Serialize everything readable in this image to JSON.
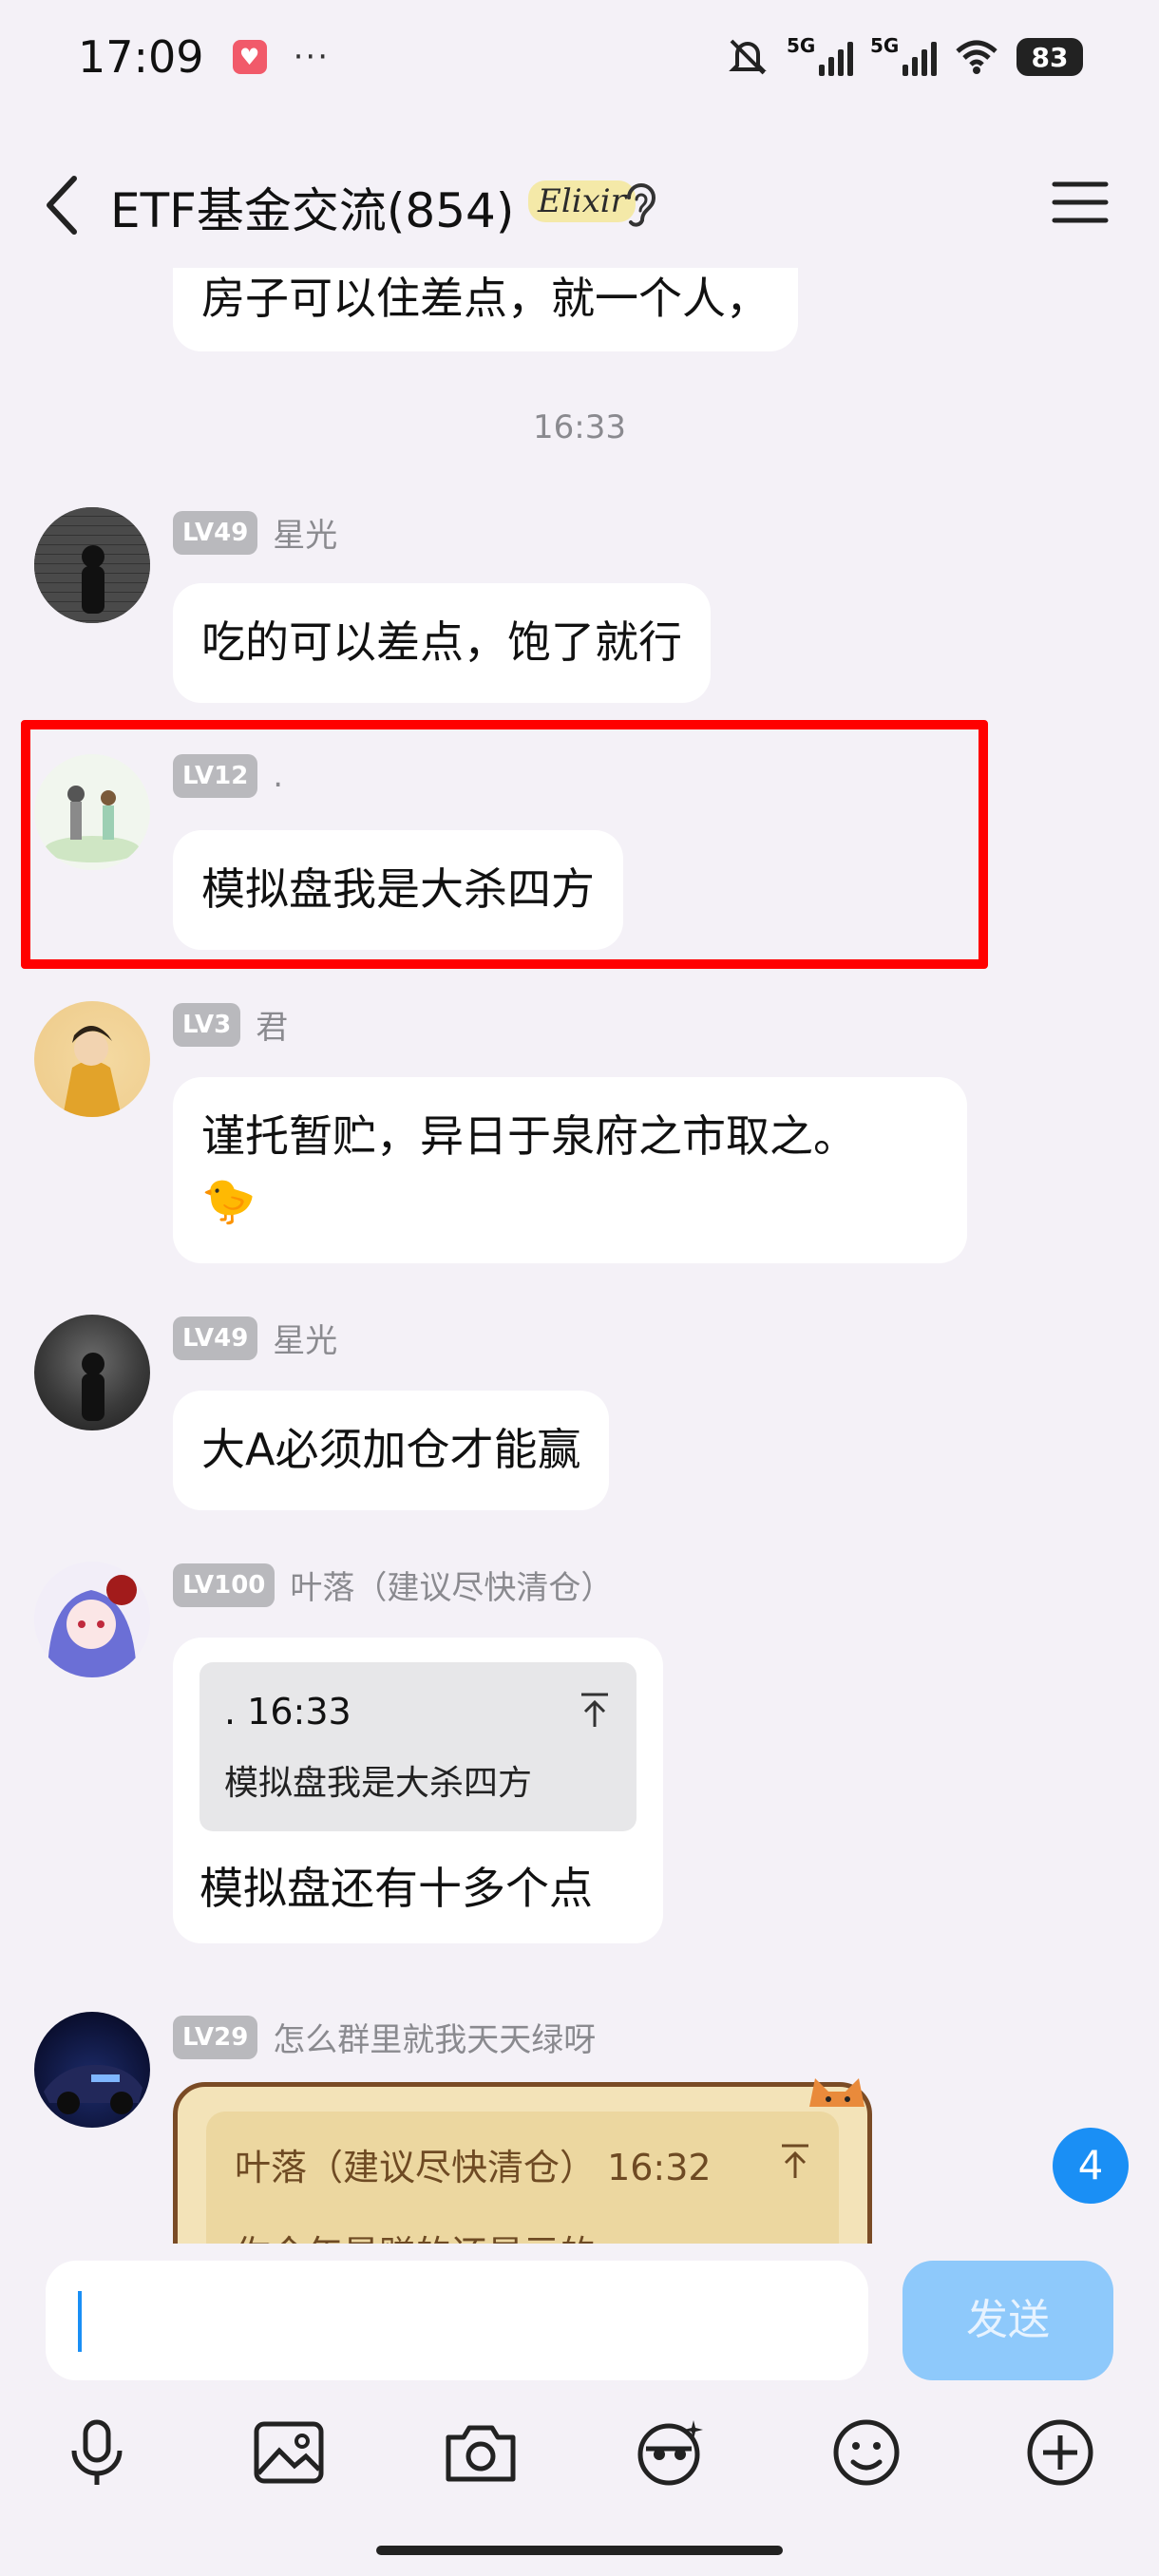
{
  "status_bar": {
    "time": "17:09",
    "app_icon": "red-app-icon",
    "more": "···",
    "network1": "5G",
    "network2": "5G",
    "battery": "83"
  },
  "header": {
    "title": "ETF基金交流(854)",
    "badge": "Elixir"
  },
  "messages": {
    "partial_top": {
      "text": "房子可以住差点，就一个人，"
    },
    "divider_time": "16:33",
    "m1": {
      "level": "LV49",
      "nick": "星光",
      "text": "吃的可以差点，饱了就行"
    },
    "m2": {
      "level": "LV12",
      "nick": ".",
      "text": "模拟盘我是大杀四方"
    },
    "m3": {
      "level": "LV3",
      "nick": "君",
      "text": "谨托暂贮，异日于泉府之市取之。",
      "emoji": "🐤"
    },
    "m4": {
      "level": "LV49",
      "nick": "星光",
      "text": "大A必须加仓才能赢"
    },
    "m5": {
      "level": "LV100",
      "nick": "叶落（建议尽快清仓）",
      "quote_head": ". 16:33",
      "quote_body": "模拟盘我是大杀四方",
      "text": "模拟盘还有十多个点"
    },
    "m6": {
      "level": "LV29",
      "nick": "怎么群里就我天天绿呀",
      "quote_head": "叶落（建议尽快清仓） 16:32",
      "quote_body": "你今年是赚的还是亏的"
    }
  },
  "unread_count": "4",
  "input": {
    "value": "",
    "send_label": "发送"
  },
  "toolbar": [
    "microphone-icon",
    "image-icon",
    "camera-icon",
    "sticker-icon",
    "emoji-icon",
    "plus-icon"
  ],
  "colors": {
    "background": "#f4f1f7",
    "accent": "#1a8ff5",
    "highlight": "#ff0000"
  }
}
